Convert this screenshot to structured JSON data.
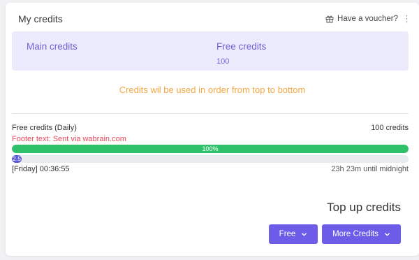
{
  "card": {
    "title": "My credits",
    "voucher_label": "Have a voucher?"
  },
  "credits": {
    "main": {
      "label": "Main credits",
      "value": ""
    },
    "free": {
      "label": "Free credits",
      "value": "100"
    }
  },
  "order_note": "Credits wil be used in order from top to bottom",
  "daily": {
    "label": "Free credits (Daily)",
    "amount": "100 credits",
    "footer_text": "Footer text: Sent via wabrain.com",
    "progress_percent": 100,
    "progress_label": "100%",
    "secondary_percent": 2.5,
    "secondary_label": "2.5",
    "time_left": "[Friday] 00:36:55",
    "time_right": "23h 23m until midnight"
  },
  "topup": {
    "title": "Top up credits",
    "buttons": [
      "Free",
      "More Credits"
    ]
  },
  "colors": {
    "accent": "#6c5ce7",
    "credits_box_bg": "#ebebfd",
    "credits_text": "#6e62d6",
    "note": "#f5a742",
    "footer_red": "#e8485a",
    "progress_green": "#2ec16a"
  },
  "icons": [
    "gift-icon",
    "more-vertical-icon",
    "chevron-down-icon"
  ]
}
